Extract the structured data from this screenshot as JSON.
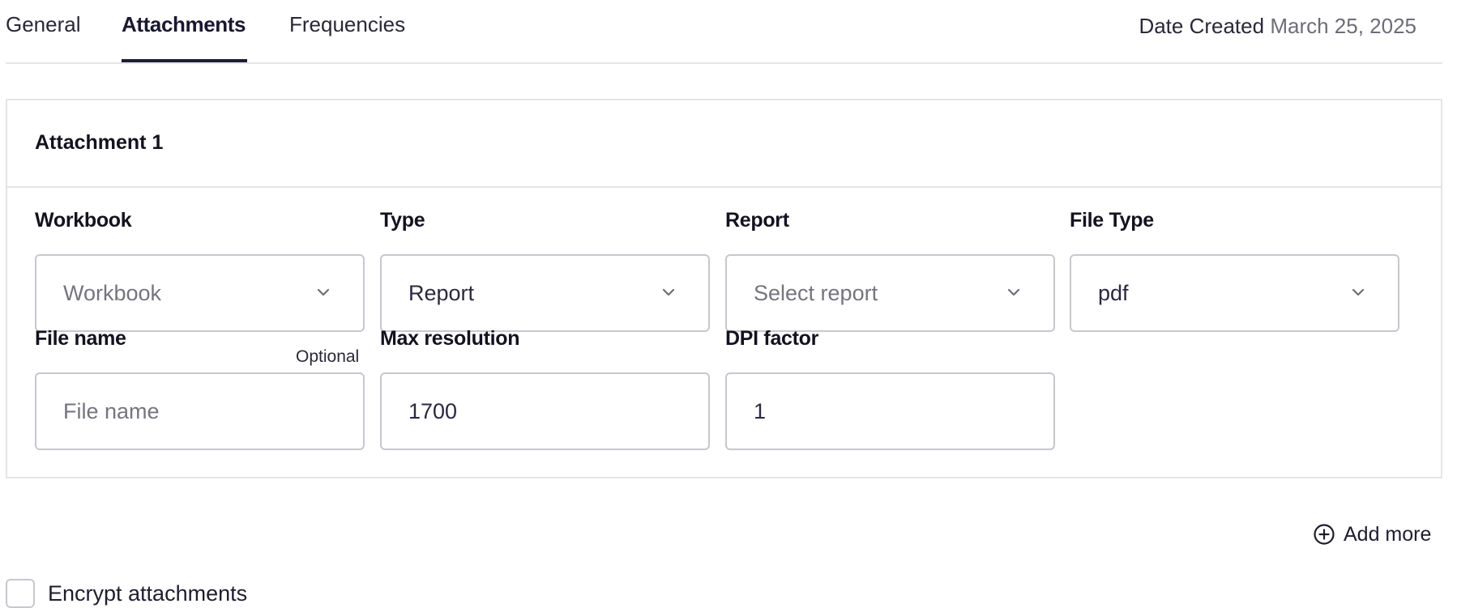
{
  "tabs": [
    {
      "label": "General",
      "active": false
    },
    {
      "label": "Attachments",
      "active": true
    },
    {
      "label": "Frequencies",
      "active": false
    }
  ],
  "date_created": {
    "label": "Date Created",
    "value": "March 25, 2025"
  },
  "attachment": {
    "title": "Attachment 1",
    "workbook": {
      "label": "Workbook",
      "placeholder": "Workbook",
      "value": ""
    },
    "type": {
      "label": "Type",
      "value": "Report"
    },
    "report": {
      "label": "Report",
      "placeholder": "Select report",
      "value": ""
    },
    "file_type": {
      "label": "File Type",
      "value": "pdf"
    },
    "file_name": {
      "label": "File name",
      "optional": "Optional",
      "placeholder": "File name",
      "value": ""
    },
    "max_resolution": {
      "label": "Max resolution",
      "value": "1700"
    },
    "dpi_factor": {
      "label": "DPI factor",
      "value": "1"
    }
  },
  "add_more": {
    "label": "Add more",
    "icon": "plus-circle-icon"
  },
  "encrypt": {
    "label": "Encrypt attachments",
    "checked": false
  },
  "colors": {
    "accent": "#1f1d33",
    "border": "#c8c7cf",
    "divider": "#e5e5e8"
  }
}
